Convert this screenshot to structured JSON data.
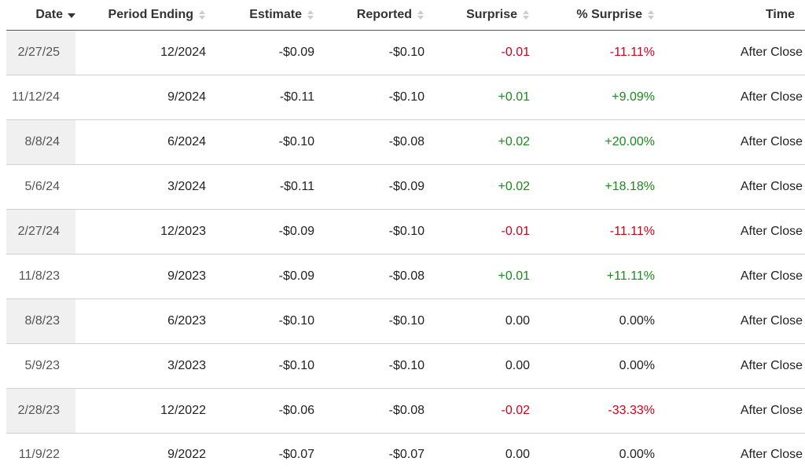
{
  "headers": {
    "date": "Date",
    "period": "Period Ending",
    "estimate": "Estimate",
    "reported": "Reported",
    "surprise": "Surprise",
    "pct_surprise": "% Surprise",
    "time": "Time"
  },
  "sort": {
    "active_column": "date",
    "direction": "descending",
    "active_icon": "sort-desc-icon",
    "inactive_icon": "sort-both-icon"
  },
  "colors": {
    "positive": "#1a8a1a",
    "negative": "#d0021b",
    "neutral": "#222222",
    "date_band": "#f0f0f0"
  },
  "rows": [
    {
      "date": "2/27/25",
      "period": "12/2024",
      "estimate": "-$0.09",
      "reported": "-$0.10",
      "surprise": "-0.01",
      "pct_surprise": "-11.11%",
      "time": "After Close",
      "sign": "neg"
    },
    {
      "date": "11/12/24",
      "period": "9/2024",
      "estimate": "-$0.11",
      "reported": "-$0.10",
      "surprise": "+0.01",
      "pct_surprise": "+9.09%",
      "time": "After Close",
      "sign": "pos"
    },
    {
      "date": "8/8/24",
      "period": "6/2024",
      "estimate": "-$0.10",
      "reported": "-$0.08",
      "surprise": "+0.02",
      "pct_surprise": "+20.00%",
      "time": "After Close",
      "sign": "pos"
    },
    {
      "date": "5/6/24",
      "period": "3/2024",
      "estimate": "-$0.11",
      "reported": "-$0.09",
      "surprise": "+0.02",
      "pct_surprise": "+18.18%",
      "time": "After Close",
      "sign": "pos"
    },
    {
      "date": "2/27/24",
      "period": "12/2023",
      "estimate": "-$0.09",
      "reported": "-$0.10",
      "surprise": "-0.01",
      "pct_surprise": "-11.11%",
      "time": "After Close",
      "sign": "neg"
    },
    {
      "date": "11/8/23",
      "period": "9/2023",
      "estimate": "-$0.09",
      "reported": "-$0.08",
      "surprise": "+0.01",
      "pct_surprise": "+11.11%",
      "time": "After Close",
      "sign": "pos"
    },
    {
      "date": "8/8/23",
      "period": "6/2023",
      "estimate": "-$0.10",
      "reported": "-$0.10",
      "surprise": "0.00",
      "pct_surprise": "0.00%",
      "time": "After Close",
      "sign": "zero"
    },
    {
      "date": "5/9/23",
      "period": "3/2023",
      "estimate": "-$0.10",
      "reported": "-$0.10",
      "surprise": "0.00",
      "pct_surprise": "0.00%",
      "time": "After Close",
      "sign": "zero"
    },
    {
      "date": "2/28/23",
      "period": "12/2022",
      "estimate": "-$0.06",
      "reported": "-$0.08",
      "surprise": "-0.02",
      "pct_surprise": "-33.33%",
      "time": "After Close",
      "sign": "neg"
    },
    {
      "date": "11/9/22",
      "period": "9/2022",
      "estimate": "-$0.07",
      "reported": "-$0.07",
      "surprise": "0.00",
      "pct_surprise": "0.00%",
      "time": "After Close",
      "sign": "zero"
    }
  ]
}
